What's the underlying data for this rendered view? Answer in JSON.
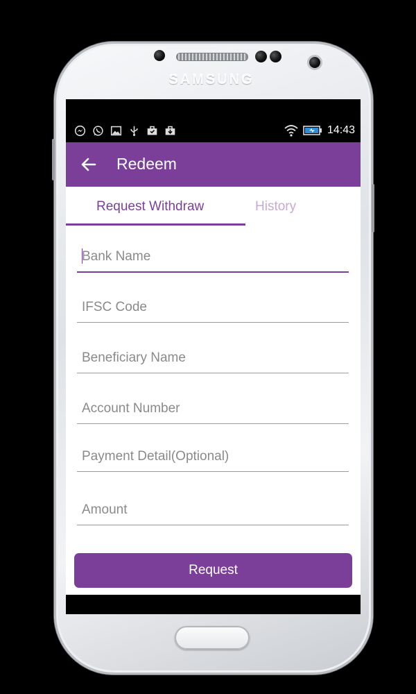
{
  "device": {
    "brand": "SAMSUNG"
  },
  "status_bar": {
    "notification_icons": [
      "messenger-icon",
      "whatsapp-icon",
      "gallery-icon",
      "usb-icon",
      "briefcase-icon",
      "download-icon"
    ],
    "wifi_icon": "wifi-icon",
    "battery_icon": "battery-charging-icon",
    "time": "14:43"
  },
  "app_bar": {
    "back_icon": "back-arrow-icon",
    "title": "Redeem",
    "color": "#7b3f99"
  },
  "tabs": [
    {
      "label": "Request Withdraw",
      "active": true
    },
    {
      "label": "History",
      "active": false
    }
  ],
  "form": {
    "fields": [
      {
        "placeholder": "Bank Name",
        "value": "",
        "focused": true
      },
      {
        "placeholder": "IFSC Code",
        "value": ""
      },
      {
        "placeholder": "Beneficiary Name",
        "value": ""
      },
      {
        "placeholder": "Account Number",
        "value": ""
      },
      {
        "placeholder": "Payment Detail(Optional)",
        "value": ""
      },
      {
        "placeholder": "Amount",
        "value": ""
      }
    ],
    "submit_label": "Request"
  },
  "colors": {
    "accent": "#7b3f99",
    "tab_inactive": "#c7a9d6"
  }
}
